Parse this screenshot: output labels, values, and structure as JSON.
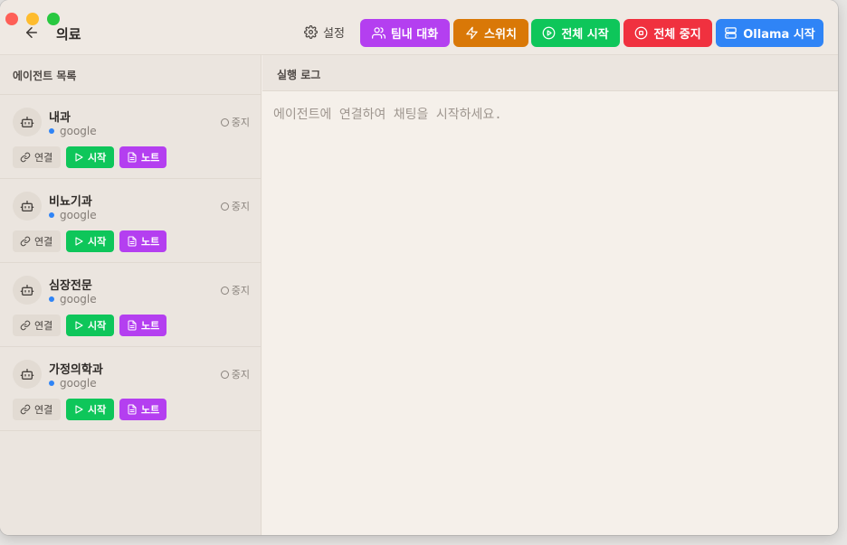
{
  "header": {
    "title": "의료",
    "settings_label": "설정",
    "buttons": {
      "team_chat": "팀내 대화",
      "switch": "스위치",
      "start_all": "전체 시작",
      "stop_all": "전체 중지",
      "ollama_start": "Ollama 시작"
    }
  },
  "colors": {
    "purple": "#b43ff0",
    "orange": "#d97807",
    "green": "#0ec65a",
    "red": "#f0313f",
    "blue": "#2f84f6"
  },
  "sidebar": {
    "title": "에이전트 목록",
    "agents": [
      {
        "name": "내과",
        "provider": "google",
        "status": "중지",
        "connect": "연결",
        "start": "시작",
        "note": "노트"
      },
      {
        "name": "비뇨기과",
        "provider": "google",
        "status": "중지",
        "connect": "연결",
        "start": "시작",
        "note": "노트"
      },
      {
        "name": "심장전문",
        "provider": "google",
        "status": "중지",
        "connect": "연결",
        "start": "시작",
        "note": "노트"
      },
      {
        "name": "가정의학과",
        "provider": "google",
        "status": "중지",
        "connect": "연결",
        "start": "시작",
        "note": "노트"
      }
    ]
  },
  "log": {
    "title": "실행 로그",
    "empty_message": "에이전트에 연결하여 채팅을 시작하세요."
  },
  "icons": {
    "back": "arrow-left-icon",
    "settings": "gear-icon",
    "team": "users-icon",
    "switch": "zap-icon",
    "start_all": "play-circle-icon",
    "stop_all": "stop-circle-icon",
    "ollama": "server-icon",
    "agent": "bot-icon",
    "connect": "link-icon",
    "start": "play-icon",
    "note": "file-text-icon"
  }
}
